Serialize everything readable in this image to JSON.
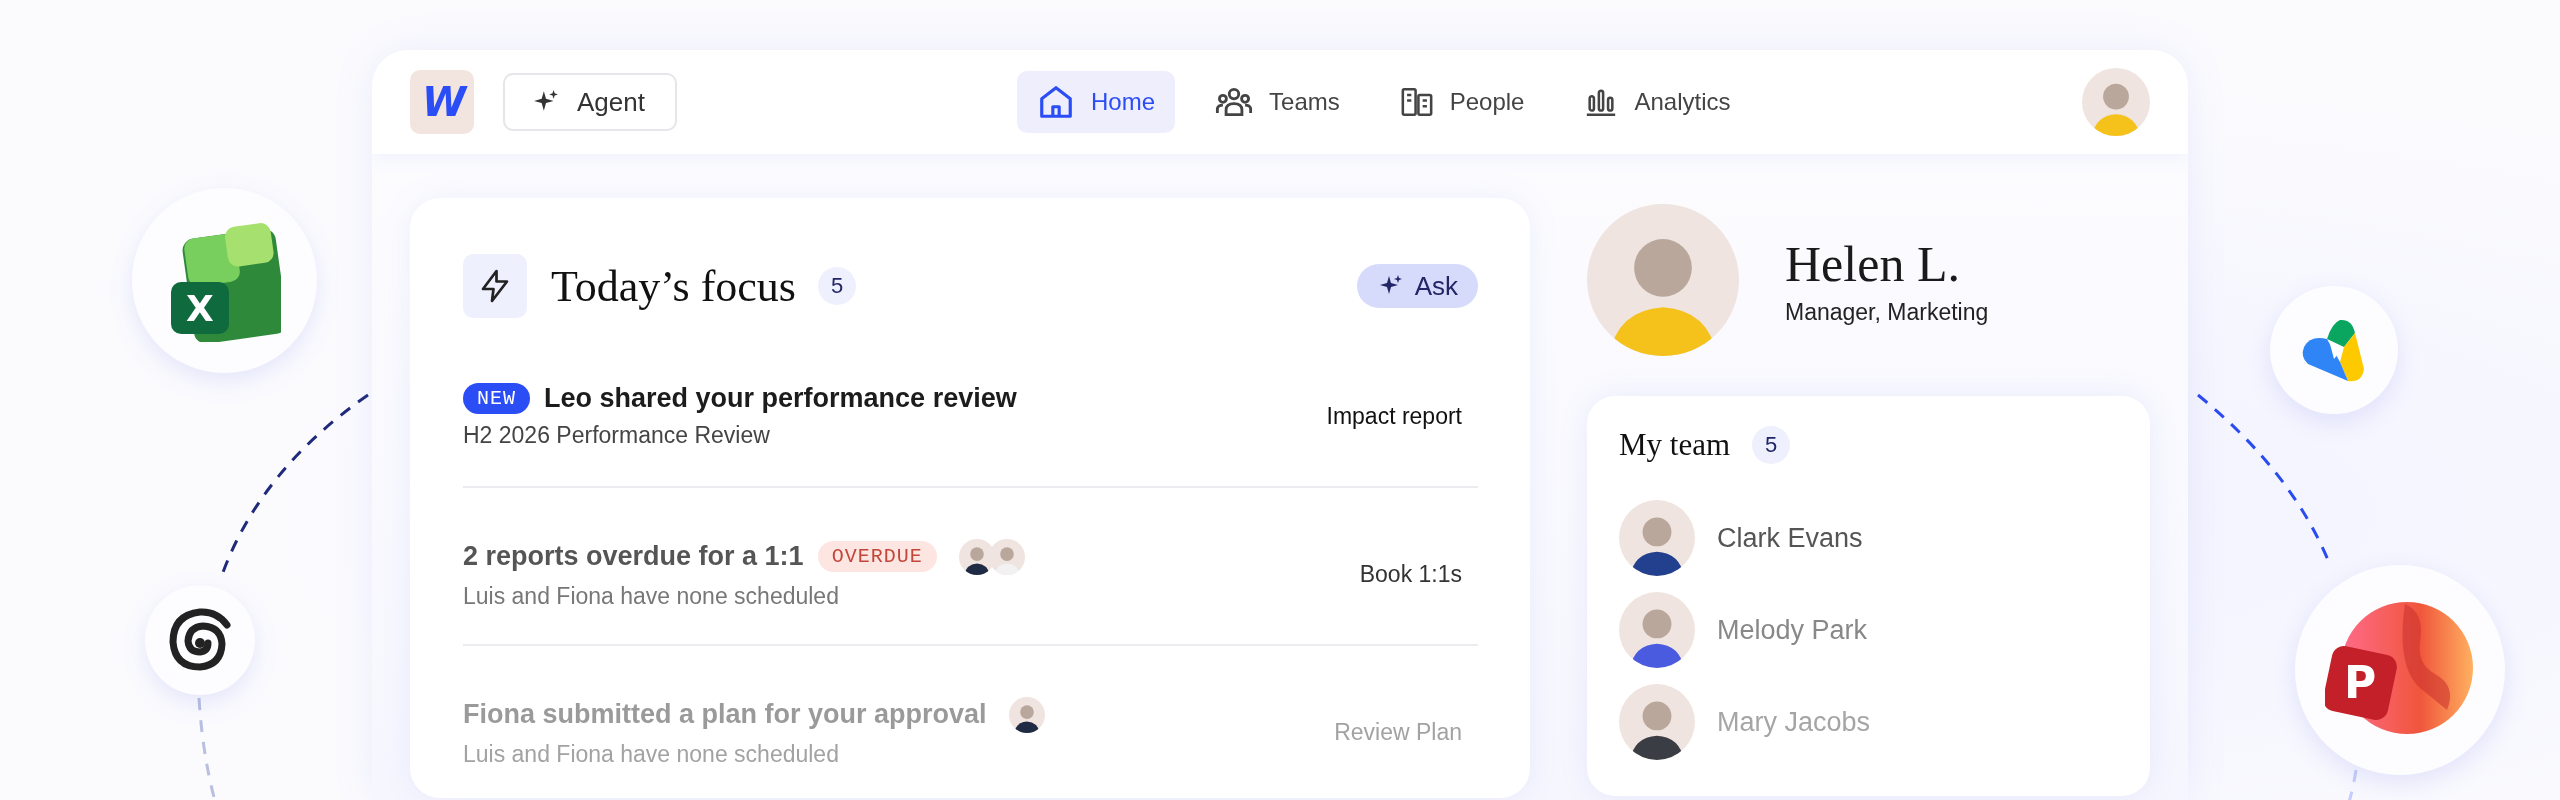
{
  "logo": {
    "text": "W"
  },
  "agent_button": {
    "label": "Agent"
  },
  "nav_tabs": [
    {
      "label": "Home",
      "selected": true
    },
    {
      "label": "Teams",
      "selected": false
    },
    {
      "label": "People",
      "selected": false
    },
    {
      "label": "Analytics",
      "selected": false
    }
  ],
  "focus": {
    "title": "Today’s focus",
    "count": "5",
    "ask_button": "Ask",
    "items": [
      {
        "badge": {
          "kind": "new",
          "label": "NEW"
        },
        "title": "Leo shared your performance review",
        "subtitle": "H2 2026 Performance Review",
        "action": "Impact report"
      },
      {
        "badge": {
          "kind": "overdue",
          "label": "OVERDUE"
        },
        "title": "2 reports overdue for a 1:1",
        "subtitle": "Luis and Fiona have none scheduled",
        "action": "Book 1:1s",
        "avatars": [
          {
            "color": "#1f2a44"
          },
          {
            "color": "#f2f2f2"
          }
        ]
      },
      {
        "title": "Fiona submitted a plan for your approval",
        "subtitle": "Luis and Fiona have none scheduled",
        "action": "Review Plan",
        "avatars": [
          {
            "color": "#1f2a44"
          }
        ]
      }
    ]
  },
  "profile": {
    "name": "Helen L.",
    "role": "Manager, Marketing"
  },
  "team": {
    "title": "My team",
    "count": "5",
    "members": [
      {
        "name": "Clark Evans",
        "color": "#23408e"
      },
      {
        "name": "Melody Park",
        "color": "#4a5be0"
      },
      {
        "name": "Mary Jacobs",
        "color": "#3a3d44"
      }
    ]
  },
  "floating_apps": [
    {
      "kind": "spreadsheet",
      "letter": "X"
    },
    {
      "kind": "spiral"
    },
    {
      "kind": "triangle"
    },
    {
      "kind": "presentation",
      "letter": "P"
    }
  ]
}
